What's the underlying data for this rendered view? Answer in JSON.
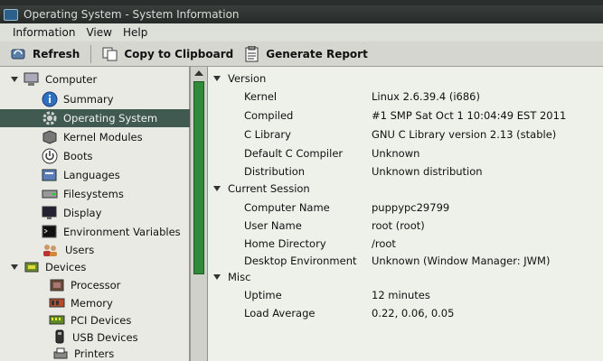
{
  "window": {
    "title": "Operating System - System Information"
  },
  "menu": {
    "items": [
      "Information",
      "View",
      "Help"
    ]
  },
  "toolbar": {
    "refresh": "Refresh",
    "copy": "Copy to Clipboard",
    "report": "Generate Report"
  },
  "sidebar": {
    "computer": "Computer",
    "summary": "Summary",
    "os": "Operating System",
    "kernel_modules": "Kernel Modules",
    "boots": "Boots",
    "languages": "Languages",
    "filesystems": "Filesystems",
    "display": "Display",
    "env_vars": "Environment Variables",
    "users": "Users",
    "devices": "Devices",
    "processor": "Processor",
    "memory": "Memory",
    "pci": "PCI Devices",
    "usb": "USB Devices",
    "printers": "Printers"
  },
  "details": {
    "sections": [
      {
        "title": "Version",
        "rows": [
          {
            "key": "Kernel",
            "value": "Linux 2.6.39.4 (i686)"
          },
          {
            "key": "Compiled",
            "value": "#1 SMP Sat Oct 1 10:04:49 EST 2011"
          },
          {
            "key": "C Library",
            "value": "GNU C Library version 2.13 (stable)"
          },
          {
            "key": "Default C Compiler",
            "value": "Unknown"
          },
          {
            "key": "Distribution",
            "value": "Unknown distribution"
          }
        ]
      },
      {
        "title": "Current Session",
        "rows": [
          {
            "key": "Computer Name",
            "value": "puppypc29799"
          },
          {
            "key": "User Name",
            "value": "root (root)"
          },
          {
            "key": "Home Directory",
            "value": "/root"
          },
          {
            "key": "Desktop Environment",
            "value": "Unknown (Window Manager: JWM)"
          }
        ]
      },
      {
        "title": "Misc",
        "rows": [
          {
            "key": "Uptime",
            "value": "12 minutes"
          },
          {
            "key": "Load Average",
            "value": "0.22, 0.06, 0.05"
          }
        ]
      }
    ]
  },
  "colors": {
    "selection": "#405a52",
    "scroll_thumb": "#2f8a3a",
    "titlebar": "#2a2e2c"
  }
}
